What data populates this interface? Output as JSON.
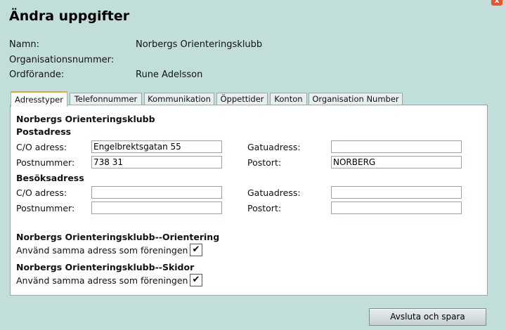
{
  "dialog": {
    "title": "Ändra uppgifter",
    "close_glyph": "x"
  },
  "info": [
    {
      "label": "Namn:",
      "value": "Norbergs Orienteringsklubb"
    },
    {
      "label": "Organisationsnummer:",
      "value": ""
    },
    {
      "label": "Ordförande:",
      "value": "Rune Adelsson"
    }
  ],
  "tabs": [
    {
      "label": "Adresstyper",
      "active": true
    },
    {
      "label": "Telefonnummer",
      "active": false
    },
    {
      "label": "Kommunikation",
      "active": false
    },
    {
      "label": "Öppettider",
      "active": false
    },
    {
      "label": "Konton",
      "active": false
    },
    {
      "label": "Organisation Number",
      "active": false
    }
  ],
  "panel": {
    "org_name": "Norbergs Orienteringsklubb",
    "postadress": {
      "heading": "Postadress",
      "co_label": "C/O adress:",
      "co_value": "Engelbrektsgatan 55",
      "street_label": "Gatuadress:",
      "street_value": "",
      "zip_label": "Postnummer:",
      "zip_value": "738 31",
      "city_label": "Postort:",
      "city_value": "NORBERG"
    },
    "besoksadress": {
      "heading": "Besöksadress",
      "co_label": "C/O adress:",
      "co_value": "",
      "street_label": "Gatuadress:",
      "street_value": "",
      "zip_label": "Postnummer:",
      "zip_value": "",
      "city_label": "Postort:",
      "city_value": ""
    },
    "sections": [
      {
        "heading": "Norbergs Orienteringsklubb--Orientering",
        "checkbox_label": "Använd samma adress som föreningen",
        "checked": true
      },
      {
        "heading": "Norbergs Orienteringsklubb--Skidor",
        "checkbox_label": "Använd samma adress som föreningen",
        "checked": true
      }
    ]
  },
  "buttons": {
    "save_label": "Avsluta och spara"
  },
  "colors": {
    "background": "#c2dedb",
    "active_tab_accent": "#e7a54a",
    "close_button": "#e8552b"
  }
}
